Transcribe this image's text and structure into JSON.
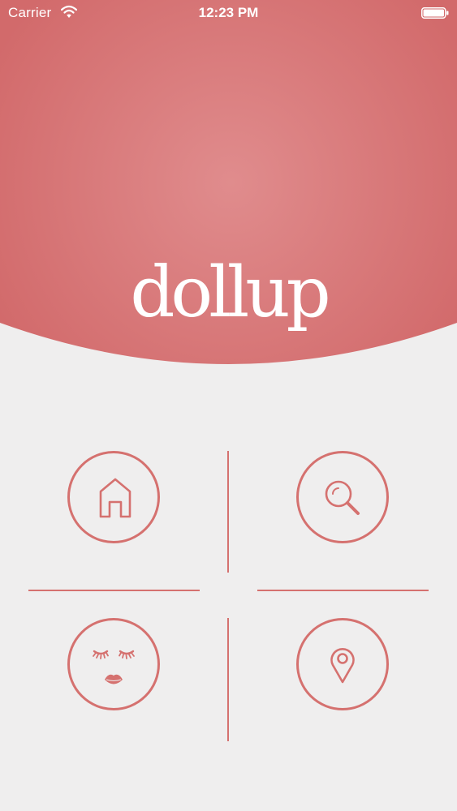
{
  "status_bar": {
    "carrier": "Carrier",
    "time": "12:23 PM"
  },
  "hero": {
    "logo_text": "dollup",
    "color_center": "#e08c8d",
    "color_edge": "#d26a6b"
  },
  "menu": {
    "accent_color": "#d5716f",
    "items": [
      {
        "name": "home",
        "icon": "home-icon"
      },
      {
        "name": "search",
        "icon": "search-icon"
      },
      {
        "name": "beauty",
        "icon": "face-lashes-lips-icon"
      },
      {
        "name": "location",
        "icon": "location-pin-icon"
      }
    ]
  }
}
